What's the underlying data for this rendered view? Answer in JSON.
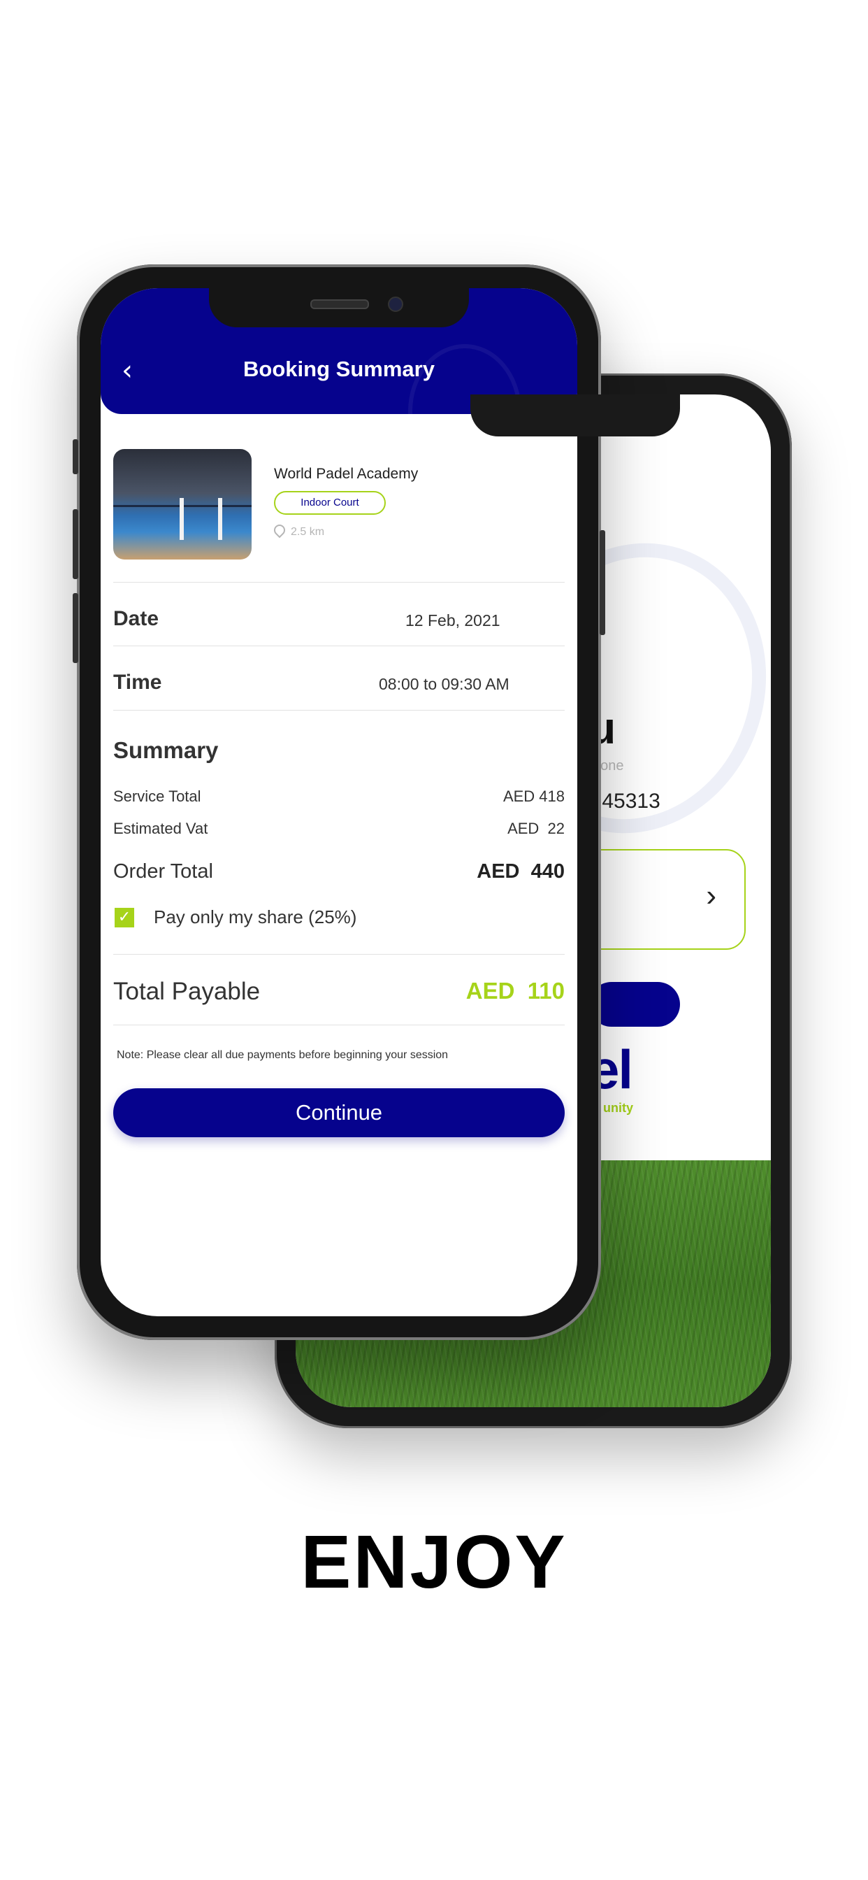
{
  "back_screen": {
    "thanks_partial": "ou",
    "sub_partial": "n Done",
    "code_partial": "C345313",
    "logo_partial": "el",
    "logo_sub_partial": "unity",
    "chevron_glyph": "›"
  },
  "header": {
    "title": "Booking Summary",
    "back_glyph": "‹"
  },
  "venue": {
    "name": "World Padel Academy",
    "court_type": "Indoor Court",
    "distance": "2.5 km"
  },
  "details": {
    "date_label": "Date",
    "date_value": "12 Feb, 2021",
    "time_label": "Time",
    "time_value": "08:00 to 09:30 AM"
  },
  "summary": {
    "title": "Summary",
    "service_total_label": "Service Total",
    "service_total_value": "AED 418",
    "vat_label": "Estimated Vat",
    "vat_value": "AED  22",
    "order_total_label": "Order Total",
    "order_total_value": "AED  440",
    "share_label": "Pay only my share (25%)",
    "share_checked": true,
    "payable_label": "Total Payable",
    "payable_value": "AED  110"
  },
  "note": "Note: Please clear all due payments before beginning your session",
  "continue_label": "Continue",
  "tagline": "ENJOY",
  "colors": {
    "primary": "#06038d",
    "accent": "#a6d31a"
  }
}
